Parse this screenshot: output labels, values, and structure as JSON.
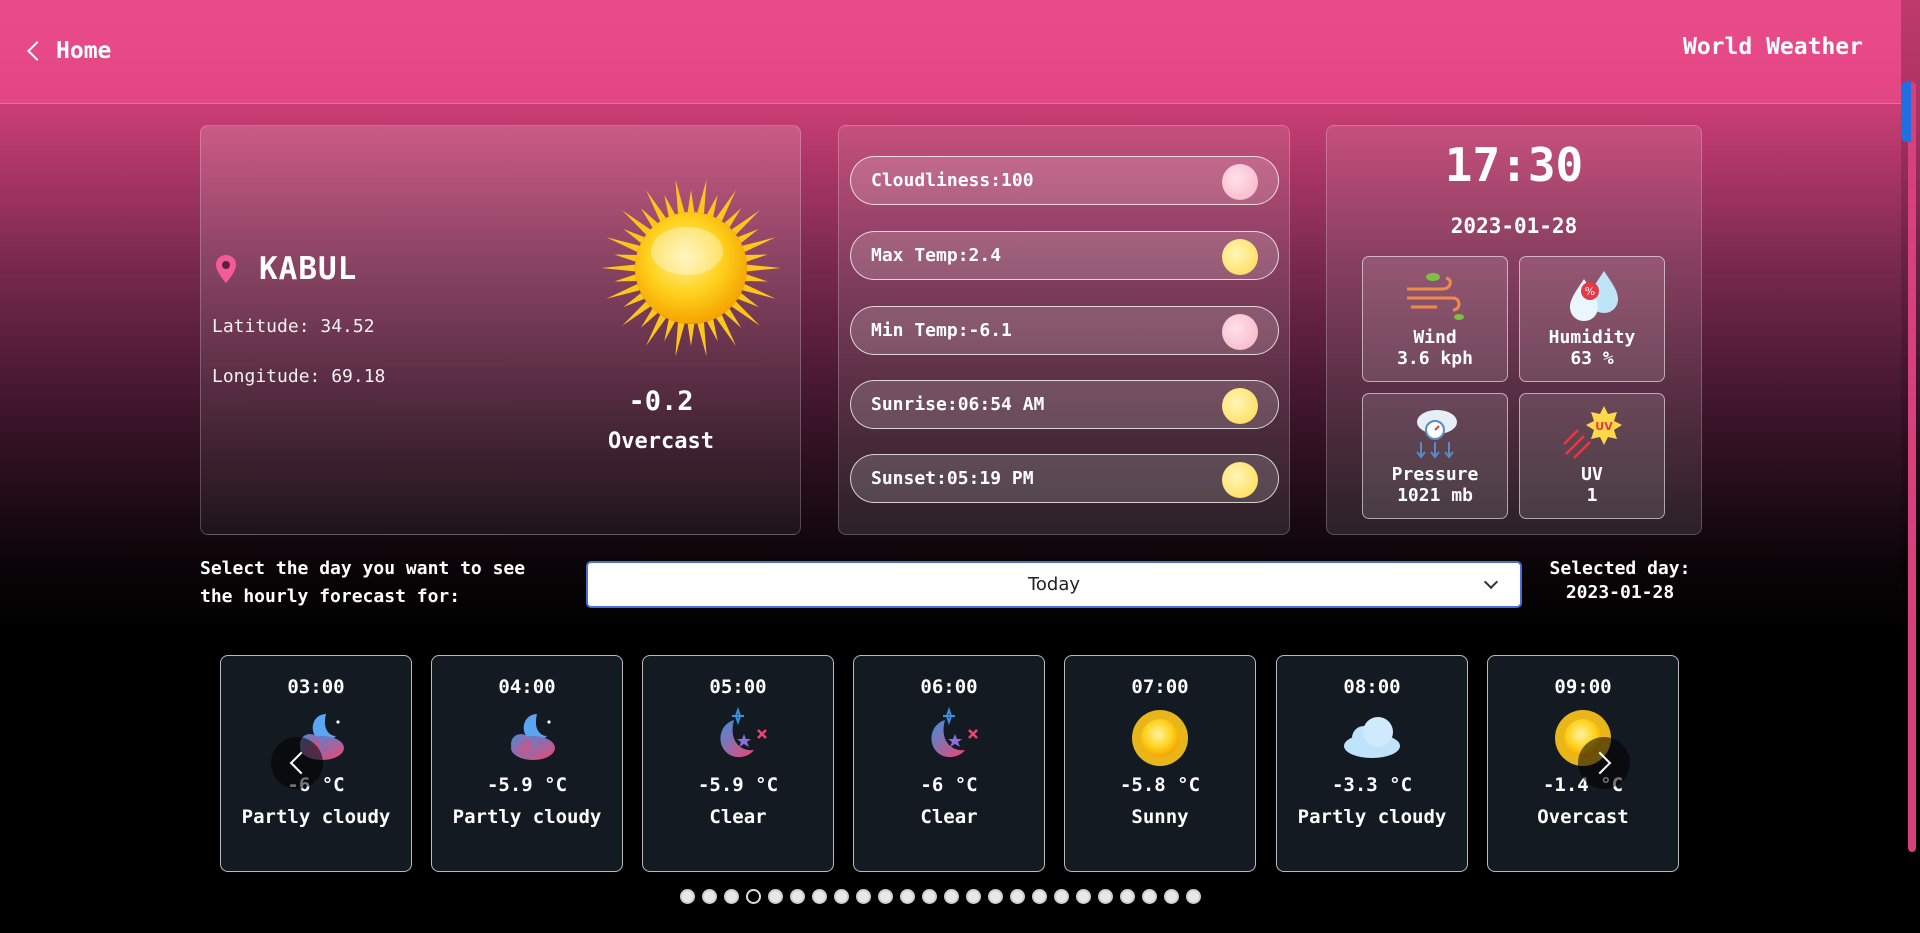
{
  "header": {
    "home_label": "Home",
    "brand": "World Weather"
  },
  "location": {
    "city": "KABUL",
    "latitude_label": "Latitude: 34.52",
    "longitude_label": "Longitude: 69.18",
    "temperature": "-0.2",
    "condition": "Overcast",
    "icons": {
      "pin": "location-pin-icon",
      "weather": "sun-icon"
    }
  },
  "stats": [
    {
      "label": "Cloudliness:100",
      "icon": "cloud-sun-icon"
    },
    {
      "label": "Max Temp:2.4",
      "icon": "thermometer-hot-icon"
    },
    {
      "label": "Min Temp:-6.1",
      "icon": "thermometer-cold-icon"
    },
    {
      "label": "Sunrise:06:54 AM",
      "icon": "sunrise-icon"
    },
    {
      "label": "Sunset:05:19 PM",
      "icon": "sunset-icon"
    }
  ],
  "time": {
    "clock": "17:30",
    "date": "2023-01-28",
    "metrics": [
      {
        "label": "Wind",
        "value": "3.6 kph",
        "icon": "wind-icon"
      },
      {
        "label": "Humidity",
        "value": "63 %",
        "icon": "humidity-icon"
      },
      {
        "label": "Pressure",
        "value": "1021 mb",
        "icon": "pressure-icon"
      },
      {
        "label": "UV",
        "value": "1",
        "icon": "uv-icon"
      }
    ]
  },
  "forecast": {
    "select_label": "Select the day you want to see the hourly forecast for:",
    "selected_option": "Today",
    "selected_day_label": "Selected day:",
    "selected_day_value": "2023-01-28",
    "hours": [
      {
        "time": "03:00",
        "temp": "-6 °C",
        "cond": "Partly cloudy",
        "icon": "moon-cloud-icon"
      },
      {
        "time": "04:00",
        "temp": "-5.9 °C",
        "cond": "Partly cloudy",
        "icon": "moon-cloud-icon"
      },
      {
        "time": "05:00",
        "temp": "-5.9 °C",
        "cond": "Clear",
        "icon": "moon-stars-icon"
      },
      {
        "time": "06:00",
        "temp": "-6 °C",
        "cond": "Clear",
        "icon": "moon-stars-icon"
      },
      {
        "time": "07:00",
        "temp": "-5.8 °C",
        "cond": "Sunny",
        "icon": "sun-icon"
      },
      {
        "time": "08:00",
        "temp": "-3.3 °C",
        "cond": "Partly cloudy",
        "icon": "cloud-icon"
      },
      {
        "time": "09:00",
        "temp": "-1.4 °C",
        "cond": "Overcast",
        "icon": "sun-icon"
      }
    ],
    "dot_count": 24,
    "active_dot": 3
  },
  "colors": {
    "header": "#ea4c89",
    "accent": "#f06292",
    "card_dark": "#141a22"
  }
}
